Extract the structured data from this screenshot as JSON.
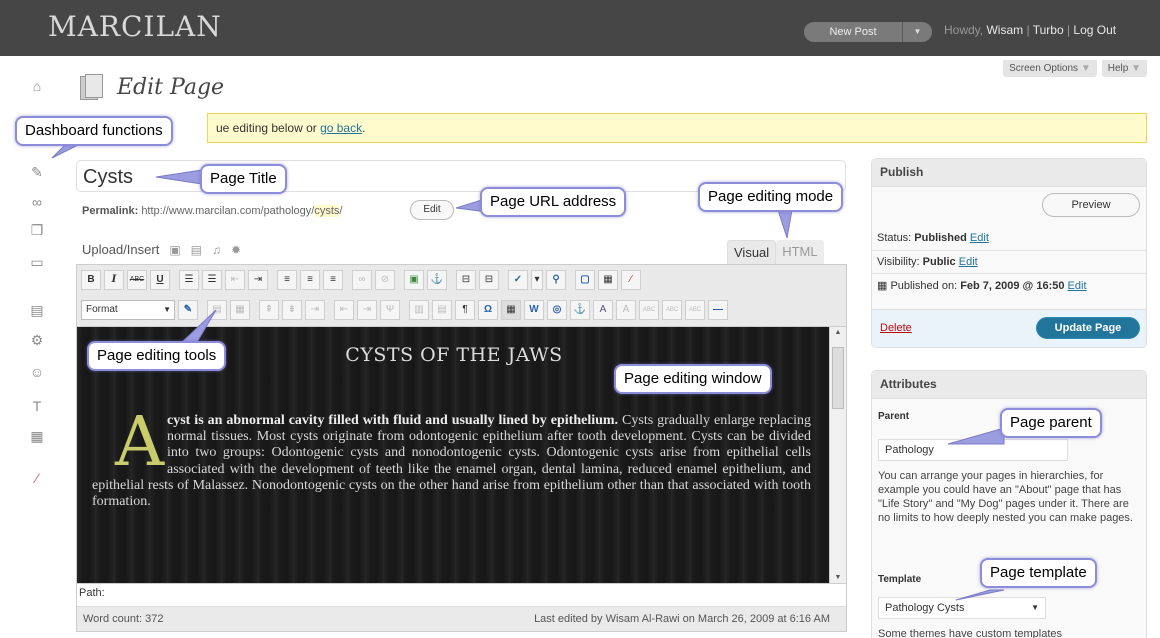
{
  "topbar": {
    "site_name": "MARCILAN",
    "new_post_label": "New Post",
    "new_post_arrow": "▼",
    "howdy": "Howdy, ",
    "user": "Wisam",
    "sep1": " | ",
    "turbo": "Turbo",
    "sep2": " | ",
    "logout": "Log Out"
  },
  "screen_options_label": "Screen Options",
  "help_label": "Help",
  "dropdown_arrow": "▼",
  "sidebar_icons": [
    "house-icon",
    "posts-icon",
    "links-icon",
    "pages-icon",
    "comments-icon",
    "appearance-icon",
    "plugins-icon",
    "users-icon",
    "tools-icon",
    "settings-icon",
    "extra-icon"
  ],
  "page_heading": "Edit Page",
  "notice": {
    "text": "ue editing below or ",
    "link": "go back",
    "end": "."
  },
  "editor": {
    "title_value": "Cysts",
    "permalink_label": "Permalink:",
    "permalink_base": "http://www.marcilan.com/pathology/",
    "permalink_slug": "cysts",
    "permalink_end": "/",
    "permalink_edit": "Edit",
    "upload_label": "Upload/Insert",
    "tab_visual": "Visual",
    "tab_html": "HTML",
    "format_label": "Format",
    "content_title": "CYSTS OF THE JAWS",
    "dropcap": "A",
    "content_lead": "cyst is an abnormal cavity filled with fluid and usually lined by epithelium.",
    "content_rest": " Cysts gradually enlarge replacing normal tissues. Most cysts originate from odontogenic epithelium after tooth development. Cysts can be divided into two groups: Odontogenic cysts and nonodontogenic cysts. Odontogenic cysts arise from epithelial cells associated with the development of teeth like the enamel organ, dental lamina, reduced enamel epithelium, and epithelial rests of Malassez. Nonodontogenic cysts on the other hand arise from epithelium other than that associated with tooth formation.",
    "path_label": "Path:",
    "word_count": "Word count: 372",
    "last_edited": "Last edited by Wisam Al-Rawi on March 26, 2009 at 6:16 AM"
  },
  "publish": {
    "heading": "Publish",
    "preview": "Preview",
    "status_label": "Status: ",
    "status_value": "Published",
    "visibility_label": "Visibility: ",
    "visibility_value": "Public",
    "edit": "Edit",
    "published_on_label": "Published on: ",
    "published_on_value": "Feb 7, 2009 @ 16:50",
    "delete": "Delete",
    "update": "Update Page"
  },
  "attributes": {
    "heading": "Attributes",
    "parent_label": "Parent",
    "parent_value": "Pathology",
    "help_text": "You can arrange your pages in hierarchies, for example you could have an \"About\" page that has \"Life Story\" and \"My Dog\" pages under it. There are no limits to how deeply nested you can make pages.",
    "template_label": "Template",
    "template_value": "Pathology Cysts",
    "template_help": "Some themes have custom templates"
  },
  "callouts": {
    "dashboard": "Dashboard functions",
    "page_title": "Page Title",
    "page_url": "Page URL address",
    "editing_mode": "Page editing mode",
    "editing_tools": "Page editing tools",
    "editing_window": "Page editing window",
    "page_parent": "Page parent",
    "page_template": "Page template"
  },
  "colors": {
    "topbar": "#464646",
    "callout_border": "#8c8cd8",
    "link": "#21759b",
    "update_button": "#21759b",
    "notice_bg": "#fffbcc"
  }
}
